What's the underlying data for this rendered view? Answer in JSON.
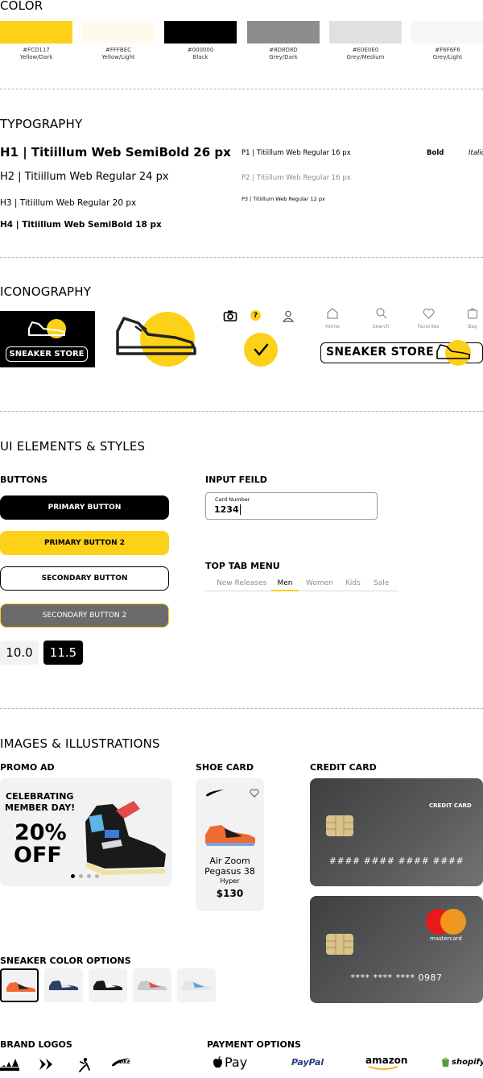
{
  "colors": {
    "title": "COLOR",
    "swatches": [
      {
        "hex": "#FCD117",
        "code": "#FCD117",
        "name": "Yellow/Dark"
      },
      {
        "hex": "#FFFBEC",
        "code": "#FFFBEC",
        "name": "Yellow/Light"
      },
      {
        "hex": "#000000",
        "code": "#000000",
        "name": "Black"
      },
      {
        "hex": "#8D8D8D",
        "code": "#8D8D8D",
        "name": "Grey/Dark"
      },
      {
        "hex": "#E0E0E0",
        "code": "#E0E0E0",
        "name": "Grey/Medium"
      },
      {
        "hex": "#F6F6F6",
        "code": "#F6F6F6",
        "name": "Grey/Light"
      }
    ]
  },
  "typography": {
    "title": "TYPOGRAPHY",
    "h1": "H1 | Titiillum Web SemiBold 26 px",
    "h2": "H2 | Titiillum Web Regular 24 px",
    "h3": "H3 | Titiillum Web Regular 20 px",
    "h4": "H4 | Titiillum Web SemiBold 18 px",
    "p1": "P1 | Titiillum Web Regular 16 px",
    "p2": "P2 | Titiillum Web Regular 16 px",
    "p3": "P3 | Titiillum Web Regular 12 px",
    "bold": "Bold",
    "italic": "Italic"
  },
  "iconography": {
    "title": "ICONOGRAPHY",
    "store_label": "SNEAKER STORE",
    "store_banner": "SNEAKER STORE",
    "help_mark": "?",
    "nav": [
      "Home",
      "Search",
      "Favorites",
      "Bag"
    ]
  },
  "ui": {
    "title": "UI ELEMENTS & STYLES",
    "buttons_heading": "BUTTONS",
    "primary": "PRIMARY BUTTON",
    "primary2": "PRIMARY BUTTON 2",
    "secondary": "SECONDARY BUTTON",
    "secondary2": "SECONDARY BUTTON 2",
    "sizes": [
      "10.0",
      "11.5"
    ],
    "input_heading": "INPUT FEILD",
    "input_label": "Card Number",
    "input_value": "1234",
    "tabs_heading": "TOP TAB MENU",
    "tabs": [
      "New Releases",
      "Men",
      "Women",
      "Kids",
      "Sale"
    ],
    "active_tab": "Men"
  },
  "images": {
    "title": "IMAGES & ILLUSTRATIONS",
    "promo_heading": "PROMO AD",
    "promo_line1": "CELEBRATING",
    "promo_line2": "MEMBER DAY!",
    "promo_pct": "20%",
    "promo_off": "OFF",
    "shoe_heading": "SHOE CARD",
    "shoe_name1": "Air Zoom",
    "shoe_name2": "Pegasus 38",
    "shoe_sub": "Hyper",
    "shoe_price": "$130",
    "credit_heading": "CREDIT CARD",
    "card1_label": "CREDIT CARD",
    "card1_number": "#### #### #### ####",
    "card2_brand": "mastercard",
    "card2_number": "**** **** **** 0987",
    "options_heading": "SNEAKER COLOR OPTIONS",
    "brands_heading": "BRAND LOGOS",
    "brand_nike": "NIKE",
    "payment_heading": "PAYMENT OPTIONS",
    "pay_apple": "Pay",
    "pay_paypal": "PayPal",
    "pay_amazon": "amazon",
    "pay_shopify": "shopify"
  }
}
